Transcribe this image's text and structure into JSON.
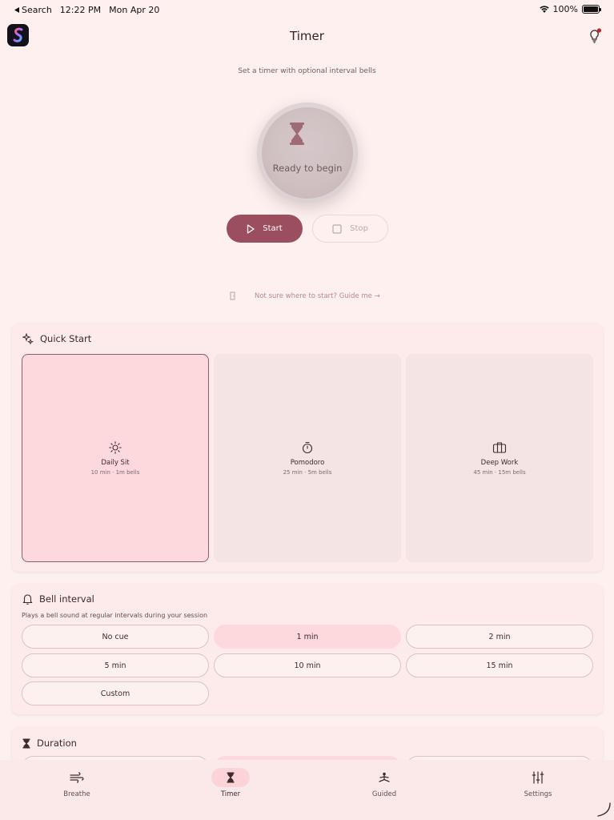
{
  "status_bar": {
    "back_label": "Search",
    "time": "12:22 PM",
    "date": "Mon Apr 20",
    "battery": "100%"
  },
  "header": {
    "title": "Timer"
  },
  "hero": {
    "subtitle": "Set a timer with optional interval bells",
    "dial_label": "Ready to begin",
    "start_label": "Start",
    "stop_label": "Stop",
    "guide_link": "Not sure where to start? Guide me →"
  },
  "quick_start": {
    "title": "Quick Start",
    "tiles": [
      {
        "name": "Daily Sit",
        "sub": "10 min · 1m bells",
        "icon": "sun-icon",
        "selected": true
      },
      {
        "name": "Pomodoro",
        "sub": "25 min · 5m bells",
        "icon": "stopwatch-icon",
        "selected": false
      },
      {
        "name": "Deep Work",
        "sub": "45 min · 15m bells",
        "icon": "briefcase-icon",
        "selected": false
      }
    ]
  },
  "bell_interval": {
    "title": "Bell interval",
    "hint": "Plays a bell sound at regular intervals during your session",
    "options": [
      "No cue",
      "1 min",
      "2 min",
      "5 min",
      "10 min",
      "15 min",
      "Custom"
    ],
    "selected": "1 min"
  },
  "duration": {
    "title": "Duration"
  },
  "bottom_nav": [
    {
      "label": "Breathe",
      "icon": "wind-icon",
      "active": false
    },
    {
      "label": "Timer",
      "icon": "hourglass-icon",
      "active": true
    },
    {
      "label": "Guided",
      "icon": "meditation-icon",
      "active": false
    },
    {
      "label": "Settings",
      "icon": "sliders-icon",
      "active": false
    }
  ],
  "colors": {
    "accent": "#9b4f5e",
    "selected_fill": "#fdd9de",
    "background": "#fdf0ef"
  }
}
